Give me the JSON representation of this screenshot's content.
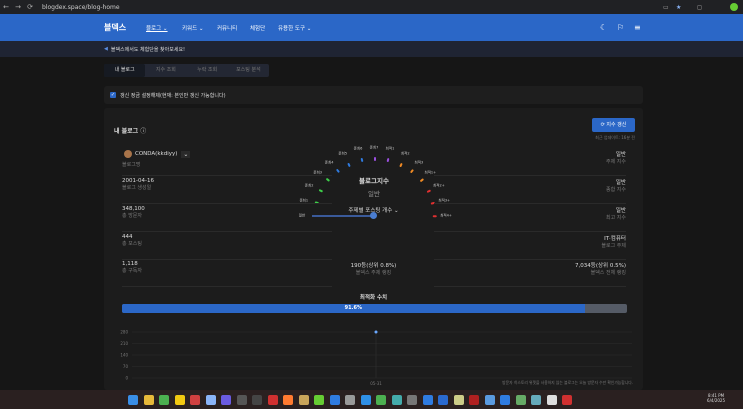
{
  "browser": {
    "url": "blogdex.space/blog-home"
  },
  "nav": {
    "logo": "블덱스",
    "items": [
      "블로그 ⌄",
      "키워드 ⌄",
      "커뮤니티",
      "체험단",
      "유용한 도구 ⌄"
    ]
  },
  "notice": {
    "text": "블덱스에서도 체험단을 찾아보세요!"
  },
  "tabs": [
    "내 블로그",
    "지수 조회",
    "누락 조회",
    "포스팅 분석"
  ],
  "checkbox": {
    "label": "갱신 정금 설정해제(현재: 본인만 갱신 가능합니다)",
    "checked": true
  },
  "card": {
    "title": "내 블로그",
    "refresh_label": "지수 갱신",
    "updated": "최근 업데이트: 16분 전",
    "blog_name": "CONDA(kkdiyy)",
    "left": [
      {
        "value": "",
        "label": "블로그명"
      },
      {
        "value": "2001-04-16",
        "label": "블로그 생성일"
      },
      {
        "value": "348,100",
        "label": "총 방문자"
      },
      {
        "value": "444",
        "label": "총 포스팅"
      },
      {
        "value": "1,118",
        "label": "총 구독자"
      }
    ],
    "right": [
      {
        "value": "일반",
        "label": "주제 지수"
      },
      {
        "value": "일반",
        "label": "종합 지수"
      },
      {
        "value": "일반",
        "label": "최고 지수"
      },
      {
        "value": "IT·컴퓨터",
        "label": "블로그 주제"
      },
      {
        "value": "7,034등(상위 0.5%)",
        "label": "블덱스 전체 랭킹"
      }
    ],
    "center_rank": {
      "value": "190등(상위 0.8%)",
      "label": "블덱스 주제 랭킹"
    },
    "gauge": {
      "title": "블로그지수",
      "current": "일반",
      "level_fraction": 0,
      "levels": [
        "일반",
        "준최1",
        "준최2",
        "준최3",
        "준최4",
        "준최5",
        "준최6",
        "준최7",
        "최적1",
        "최적2",
        "최적3",
        "최적1+",
        "최적2+",
        "최적3+",
        "최적4+"
      ],
      "colors": [
        "#888888",
        "#3ecf4a",
        "#3ecf4a",
        "#3ecf4a",
        "#2f7be0",
        "#2f7be0",
        "#2f7be0",
        "#9b4fe0",
        "#9b4fe0",
        "#f08a24",
        "#f08a24",
        "#f08a24",
        "#e03030",
        "#e03030",
        "#e03030"
      ]
    },
    "dropdown": "주제별 포스팅 개수 ⌄",
    "optimization": {
      "title": "최적화 수치",
      "percent": 91.6,
      "label": "91.6%"
    },
    "chart": {
      "yticks": [
        "280",
        "210",
        "140",
        "70",
        "0"
      ],
      "x": [
        "05-31"
      ],
      "note": "방문자 히스토리 위젯을 사용하지 않는 블로그는 오늘 방문자 수만 확인가능합니다."
    }
  },
  "clock": {
    "time": "8:41 PM",
    "date": "6/4/2025"
  }
}
